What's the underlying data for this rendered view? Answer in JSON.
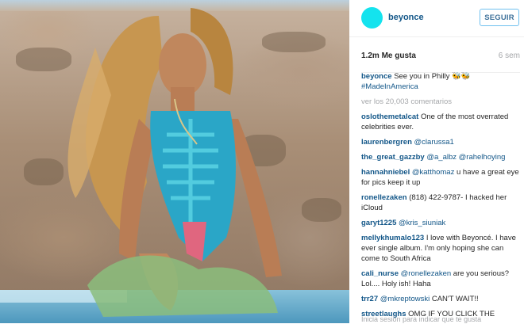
{
  "post": {
    "username": "beyonce",
    "follow_label": "SEGUIR",
    "likes": "1.2m Me gusta",
    "time_ago": "6 sem",
    "caption_user": "beyonce",
    "caption_text": "See you in Philly 🐝🐝",
    "caption_hashtag": "#MadeInAmerica",
    "view_all_comments": "ver los 20,003 comentarios",
    "footer_text": "Inicia sesión para indicar que te gusta"
  },
  "comments": [
    {
      "user": "oslothemetalcat",
      "text": "One of the most overrated celebrities ever.",
      "mention": ""
    },
    {
      "user": "laurenbergren",
      "text": "",
      "mention": "@clarussa1"
    },
    {
      "user": "the_great_gazzby",
      "text": "",
      "mention": "@a_albz @rahelhoying"
    },
    {
      "user": "hannahniebel",
      "text": "u have a great eye for pics keep it up",
      "mention": "@katthomaz"
    },
    {
      "user": "ronellezaken",
      "text": "(818) 422-9787- I hacked her iCloud",
      "mention": ""
    },
    {
      "user": "garyt1225",
      "text": "",
      "mention": "@kris_siuniak"
    },
    {
      "user": "mellykhumalo123",
      "text": "I love with Beyoncé. I have ever single album. I'm only hoping she can come to South Africa",
      "mention": ""
    },
    {
      "user": "cali_nurse",
      "text": "are you serious? Lol.... Holy ish! Haha",
      "mention": "@ronellezaken"
    },
    {
      "user": "trr27",
      "text": "CAN'T WAIT!!",
      "mention": "@mkreptowski"
    },
    {
      "user": "streetlaughs",
      "text": "OMG IF YOU CLICK THE",
      "mention": ""
    }
  ],
  "colors": {
    "avatar": "#14e3ee",
    "username": "#125688",
    "follow_border": "#70c0ef"
  },
  "icons": {
    "photo": "post-photo"
  }
}
